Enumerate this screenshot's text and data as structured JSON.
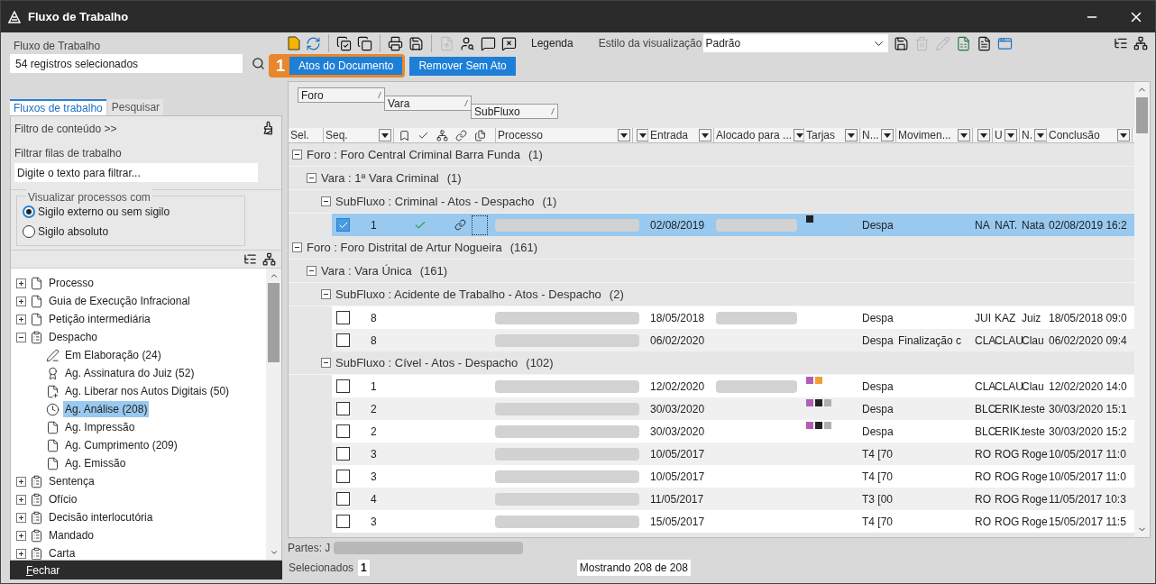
{
  "window": {
    "title": "Fluxo de Trabalho"
  },
  "left_panel": {
    "label": "Fluxo de Trabalho",
    "search_value": "54 registros selecionados",
    "tabs": [
      {
        "label": "Fluxos de trabalho",
        "selected": true
      },
      {
        "label": "Pesquisar",
        "selected": false
      }
    ],
    "content_filter": "Filtro de conteúdo >>",
    "filter_label": "Filtrar filas de trabalho",
    "filter_placeholder": "Digite o texto para filtrar...",
    "visibility": {
      "title": "Visualizar processos com",
      "options": [
        {
          "label": "Sigilo externo ou sem sigilo",
          "selected": true
        },
        {
          "label": "Sigilo absoluto",
          "selected": false
        }
      ]
    },
    "tree": [
      {
        "label": "Processo",
        "kind": "doc",
        "expanded": false,
        "selected": false
      },
      {
        "label": "Guia de Execução Infracional",
        "kind": "doc",
        "expanded": false,
        "selected": false
      },
      {
        "label": "Petição intermediária",
        "kind": "doc",
        "expanded": false,
        "selected": false
      },
      {
        "label": "Despacho",
        "kind": "stack",
        "expanded": true,
        "selected": false,
        "children": [
          {
            "label": "Em Elaboração (24)",
            "kind": "pen",
            "selected": false
          },
          {
            "label": "Ag. Assinatura do Juiz (52)",
            "kind": "seal",
            "selected": false
          },
          {
            "label": "Ag. Liberar nos Autos Digitais (50)",
            "kind": "upload",
            "selected": false
          },
          {
            "label": "Ag. Análise (208)",
            "kind": "clock",
            "selected": true
          },
          {
            "label": "Ag. Impressão",
            "kind": "doc",
            "selected": false
          },
          {
            "label": "Ag. Cumprimento (209)",
            "kind": "doc",
            "selected": false
          },
          {
            "label": "Ag. Emissão",
            "kind": "doc",
            "selected": false
          }
        ]
      },
      {
        "label": "Sentença",
        "kind": "stack",
        "expanded": false,
        "selected": false
      },
      {
        "label": "Ofício",
        "kind": "stack",
        "expanded": false,
        "selected": false
      },
      {
        "label": "Decisão interlocutória",
        "kind": "stack",
        "expanded": false,
        "selected": false
      },
      {
        "label": "Mandado",
        "kind": "stack",
        "expanded": false,
        "selected": false
      },
      {
        "label": "Carta",
        "kind": "stack",
        "expanded": false,
        "selected": false
      }
    ],
    "close_button": "Fechar"
  },
  "toolbar": {
    "legend": "Legenda",
    "style_label": "Estilo da visualização",
    "style_value": "Padrão",
    "callout": "1",
    "buttons": [
      "Atos do Documento",
      "Remover Sem Ato"
    ]
  },
  "grouping": [
    "Foro",
    "Vara",
    "SubFluxo"
  ],
  "table": {
    "columns": [
      {
        "label": "Sel.",
        "filter": false
      },
      {
        "label": "Seq.",
        "filter": true
      },
      {
        "kind": "icons"
      },
      {
        "label": "Processo",
        "filter": true
      },
      {
        "filter": true
      },
      {
        "label": "Entrada",
        "filter": true
      },
      {
        "label": "Alocado para ...",
        "filter": true
      },
      {
        "label": "Tarjas",
        "filter": true
      },
      {
        "label": "N...",
        "filter": true
      },
      {
        "label": "Movimen...",
        "filter": true
      },
      {
        "filter": true
      },
      {
        "label": "U",
        "filter": true
      },
      {
        "label": "N.",
        "filter": true
      },
      {
        "label": "Conclusão",
        "filter": true
      }
    ],
    "groups": [
      {
        "label": "Foro : Foro Central Criminal Barra Funda",
        "count": "(1)",
        "expanded": true,
        "children": [
          {
            "label": "Vara : 1ª Vara Criminal",
            "count": "(1)",
            "expanded": true,
            "children": [
              {
                "label": "SubFluxo : Criminal - Atos - Despacho",
                "count": "(1)",
                "expanded": true,
                "rows": [
                  {
                    "selected": true,
                    "checked": true,
                    "seq": "1",
                    "done": true,
                    "linked": true,
                    "entrada": "02/08/2019",
                    "alocado_redacted": true,
                    "tags": [
                      {
                        "color": "#222222"
                      }
                    ],
                    "n": "Despa",
                    "movimento": "",
                    "c1": "NA",
                    "u": "NAT.",
                    "n2": "Nata",
                    "conclusao": "02/08/2019 16:2"
                  }
                ]
              }
            ]
          }
        ]
      },
      {
        "label": "Foro : Foro Distrital de Artur Nogueira",
        "count": "(161)",
        "expanded": true,
        "children": [
          {
            "label": "Vara : Vara Única",
            "count": "(161)",
            "expanded": true,
            "children": [
              {
                "label": "SubFluxo : Acidente de Trabalho - Atos - Despacho",
                "count": "(2)",
                "expanded": true,
                "rows": [
                  {
                    "selected": false,
                    "checked": false,
                    "seq": "8",
                    "done": false,
                    "linked": false,
                    "entrada": "18/05/2018",
                    "alocado_redacted": true,
                    "tags": [],
                    "n": "Despa",
                    "movimento": "",
                    "c1": "JUI",
                    "u": "KAZ",
                    "n2": "Juiz",
                    "conclusao": "18/05/2018 09:0"
                  },
                  {
                    "selected": false,
                    "checked": false,
                    "seq": "8",
                    "done": false,
                    "linked": false,
                    "entrada": "06/02/2020",
                    "alocado_redacted": false,
                    "tags": [],
                    "n": "Despa",
                    "movimento": "Finalização c",
                    "c1": "CLA",
                    "u": "CLAU",
                    "n2": "Clau",
                    "conclusao": "06/02/2020 09:4"
                  }
                ]
              },
              {
                "label": "SubFluxo : Cível - Atos - Despacho",
                "count": "(102)",
                "expanded": true,
                "rows": [
                  {
                    "selected": false,
                    "checked": false,
                    "seq": "1",
                    "done": false,
                    "linked": false,
                    "entrada": "12/02/2020",
                    "alocado_redacted": true,
                    "tags": [
                      {
                        "color": "#b05fb5"
                      },
                      {
                        "color": "#f0a030"
                      }
                    ],
                    "n": "Despa",
                    "movimento": "",
                    "c1": "CLA",
                    "u": "CLAU",
                    "n2": "Clau",
                    "conclusao": "12/02/2020 14:0"
                  },
                  {
                    "selected": false,
                    "checked": false,
                    "seq": "2",
                    "done": false,
                    "linked": false,
                    "entrada": "30/03/2020",
                    "alocado_redacted": false,
                    "tags": [
                      {
                        "color": "#b05fb5"
                      },
                      {
                        "color": "#222222"
                      },
                      {
                        "color": "#b0b0b0"
                      }
                    ],
                    "n": "Despa",
                    "movimento": "",
                    "c1": "BLC",
                    "u": "ERIK.",
                    "n2": "teste",
                    "conclusao": "30/03/2020 15:1"
                  },
                  {
                    "selected": false,
                    "checked": false,
                    "seq": "2",
                    "done": false,
                    "linked": false,
                    "entrada": "30/03/2020",
                    "alocado_redacted": false,
                    "tags": [
                      {
                        "color": "#b05fb5"
                      },
                      {
                        "color": "#222222"
                      },
                      {
                        "color": "#b0b0b0"
                      }
                    ],
                    "n": "Despa",
                    "movimento": "",
                    "c1": "BLC",
                    "u": "ERIK.",
                    "n2": "teste",
                    "conclusao": "30/03/2020 15:2"
                  },
                  {
                    "selected": false,
                    "checked": false,
                    "seq": "3",
                    "done": false,
                    "linked": false,
                    "entrada": "10/05/2017",
                    "alocado_redacted": false,
                    "tags": [],
                    "n": "T4 [70",
                    "movimento": "",
                    "c1": "RO",
                    "u": "ROG",
                    "n2": "Roge",
                    "conclusao": "10/05/2017 11:0"
                  },
                  {
                    "selected": false,
                    "checked": false,
                    "seq": "3",
                    "done": false,
                    "linked": false,
                    "entrada": "10/05/2017",
                    "alocado_redacted": false,
                    "tags": [],
                    "n": "T4 [70",
                    "movimento": "",
                    "c1": "RO",
                    "u": "ROG",
                    "n2": "Roge",
                    "conclusao": "10/05/2017 11:0"
                  },
                  {
                    "selected": false,
                    "checked": false,
                    "seq": "4",
                    "done": false,
                    "linked": false,
                    "entrada": "11/05/2017",
                    "alocado_redacted": false,
                    "tags": [],
                    "n": "T3 [00",
                    "movimento": "",
                    "c1": "RO",
                    "u": "ROG",
                    "n2": "Roge",
                    "conclusao": "11/05/2017 10:3"
                  },
                  {
                    "selected": false,
                    "checked": false,
                    "seq": "3",
                    "done": false,
                    "linked": false,
                    "entrada": "15/05/2017",
                    "alocado_redacted": false,
                    "tags": [],
                    "n": "T4 [70",
                    "movimento": "",
                    "c1": "RO",
                    "u": "ROG",
                    "n2": "Roge",
                    "conclusao": "15/05/2017 11:5"
                  }
                ]
              }
            ]
          }
        ]
      }
    ]
  },
  "footer": {
    "parties_label": "Partes: J",
    "selected_label": "Selecionados",
    "selected_count": "1",
    "showing": "Mostrando 208 de 208"
  }
}
